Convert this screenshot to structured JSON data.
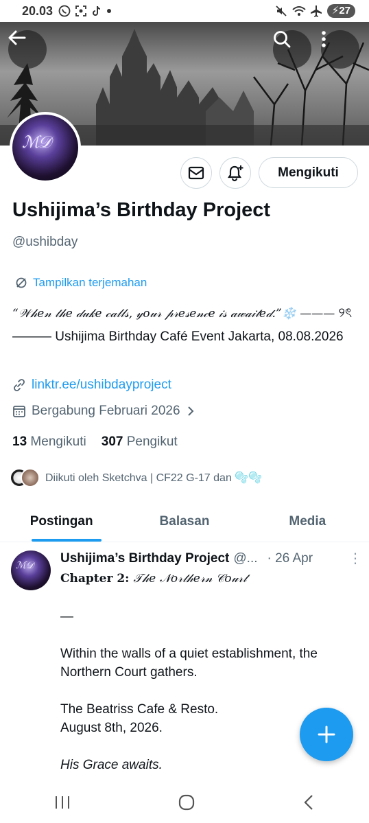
{
  "status_bar": {
    "time": "20.03",
    "battery": "27",
    "left_icons": [
      "whatsapp-icon",
      "screenshot-icon",
      "tiktok-icon",
      "dot-icon"
    ],
    "right_icons": [
      "mute-icon",
      "wifi-icon",
      "airplane-icon",
      "battery-icon"
    ]
  },
  "header": {
    "back_icon": "back-arrow-icon",
    "search_icon": "search-icon",
    "more_icon": "more-vertical-icon"
  },
  "profile": {
    "name": "Ushijima’s Birthday Project",
    "handle": "@ushibday",
    "translate_label": "Tampilkan terjemahan",
    "bio_fancy": "“𝒲𝒽𝑒𝓃 𝓉𝒽𝑒 𝒹𝓊𝓀𝑒 𝒸𝒶𝓁𝓁𝓈, 𝓎𝑜𝓊𝓇 𝓅𝓇𝑒𝓈𝑒𝓃𝒸𝑒 𝒾𝓈 𝒶𝓌𝒶𝒾𝓉𝑒𝒹.”❄️ ———",
    "bio_rest": "୨ৎ ——— Ushijima Birthday Café Event  Jakarta, 08.08.2026",
    "link": "linktr.ee/ushibdayproject",
    "joined": "Bergabung Februari 2026",
    "following_count": "13",
    "following_label": "Mengikuti",
    "followers_count": "307",
    "followers_label": "Pengikut",
    "followed_by": "Diikuti oleh Sketchva | CF22 G-17 dan 🫧🫧",
    "follow_button": "Mengikuti"
  },
  "tabs": [
    {
      "label": "Postingan",
      "active": true
    },
    {
      "label": "Balasan",
      "active": false
    },
    {
      "label": "Media",
      "active": false
    }
  ],
  "post": {
    "author": "Ushijima’s Birthday Project",
    "handle": "@...",
    "date": "· 26 Apr",
    "chapter_label": "Chapter 2:",
    "chapter_title": "𝒯𝒽𝑒 𝒩𝑜𝓇𝓉𝒽𝑒𝓇𝓃 𝒞𝑜𝓊𝓇𝓉",
    "dash": "—",
    "line1": "Within the walls of a quiet establishment, the Northern Court gathers.",
    "line2": "The Beatriss Cafe & Resto.",
    "line3": "August 8th, 2026.",
    "line4": "His Grace awaits."
  },
  "colors": {
    "accent": "#1d9bf0",
    "text": "#0f1419",
    "muted": "#536471"
  }
}
